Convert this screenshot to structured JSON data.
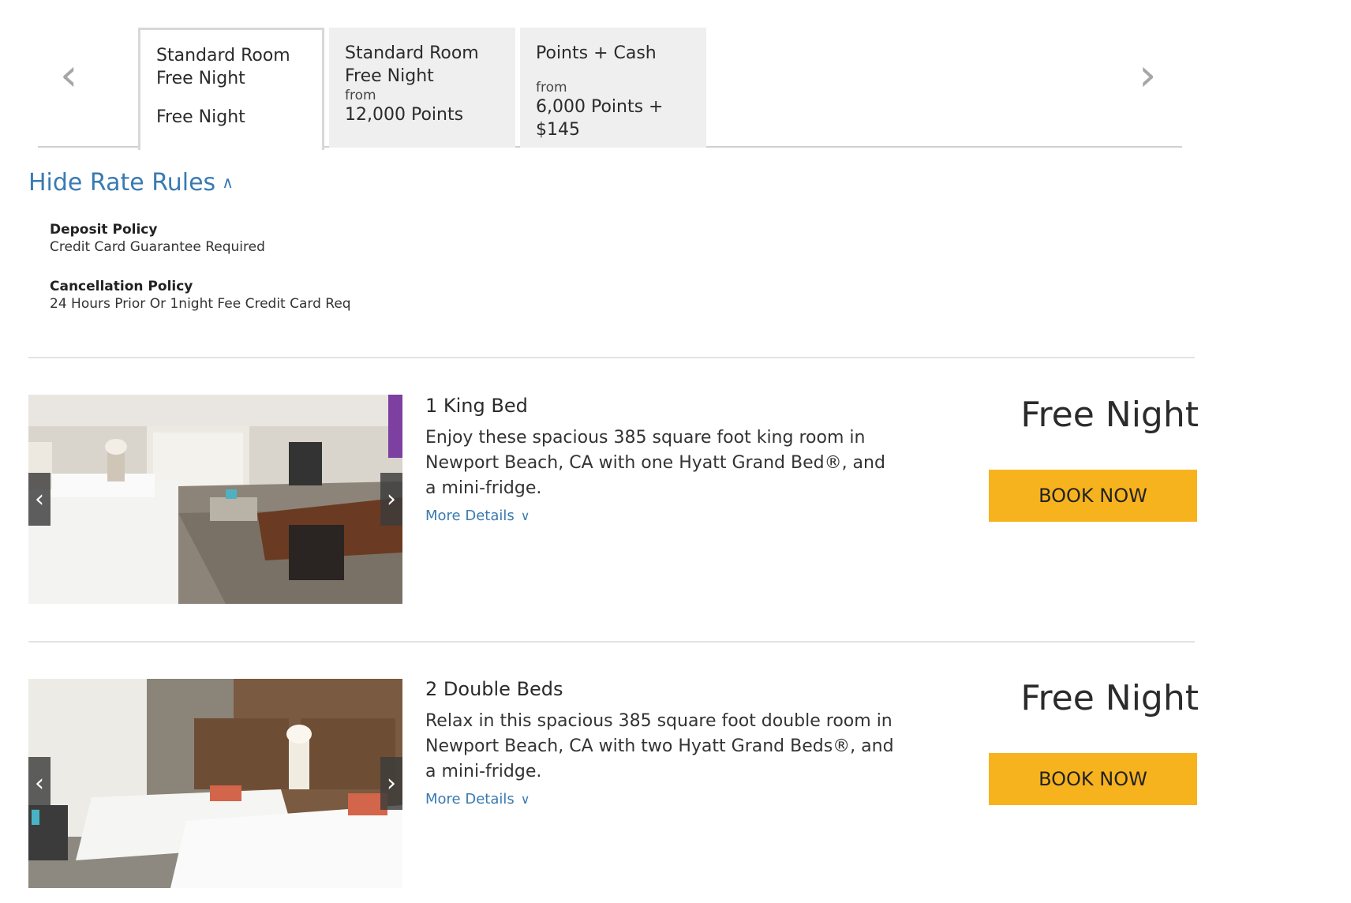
{
  "tabs": [
    {
      "name": "Standard Room\nFree Night",
      "from": "",
      "price": "Free Night",
      "active": true
    },
    {
      "name": "Standard Room\nFree Night",
      "from": "from",
      "price": "12,000 Points",
      "active": false
    },
    {
      "name": "Points + Cash",
      "from": "from",
      "price": "6,000 Points +\n$145",
      "active": false
    }
  ],
  "nav": {
    "prev_icon": "chevron-left-icon",
    "next_icon": "chevron-right-icon"
  },
  "rate_rules": {
    "toggle_label": "Hide Rate Rules",
    "toggle_icon": "chevron-up-icon",
    "policies": [
      {
        "title": "Deposit Policy",
        "value": "Credit Card Guarantee Required"
      },
      {
        "title": "Cancellation Policy",
        "value": "24 Hours Prior Or 1night Fee Credit Card Req"
      }
    ]
  },
  "rooms": [
    {
      "title": "1 King Bed",
      "description": "Enjoy these spacious 385 square foot king room in Newport Beach, CA with one Hyatt Grand Bed®, and a mini-fridge.",
      "more_details": "More Details",
      "price": "Free Night",
      "book_label": "BOOK NOW"
    },
    {
      "title": "2 Double Beds",
      "description": "Relax in this spacious 385 square foot double room in Newport Beach, CA with two Hyatt Grand Beds®, and a mini-fridge.",
      "more_details": "More Details",
      "price": "Free Night",
      "book_label": "BOOK NOW"
    }
  ],
  "colors": {
    "link": "#3a7ab2",
    "button": "#f7b31e",
    "tab_bg": "#efefef"
  }
}
